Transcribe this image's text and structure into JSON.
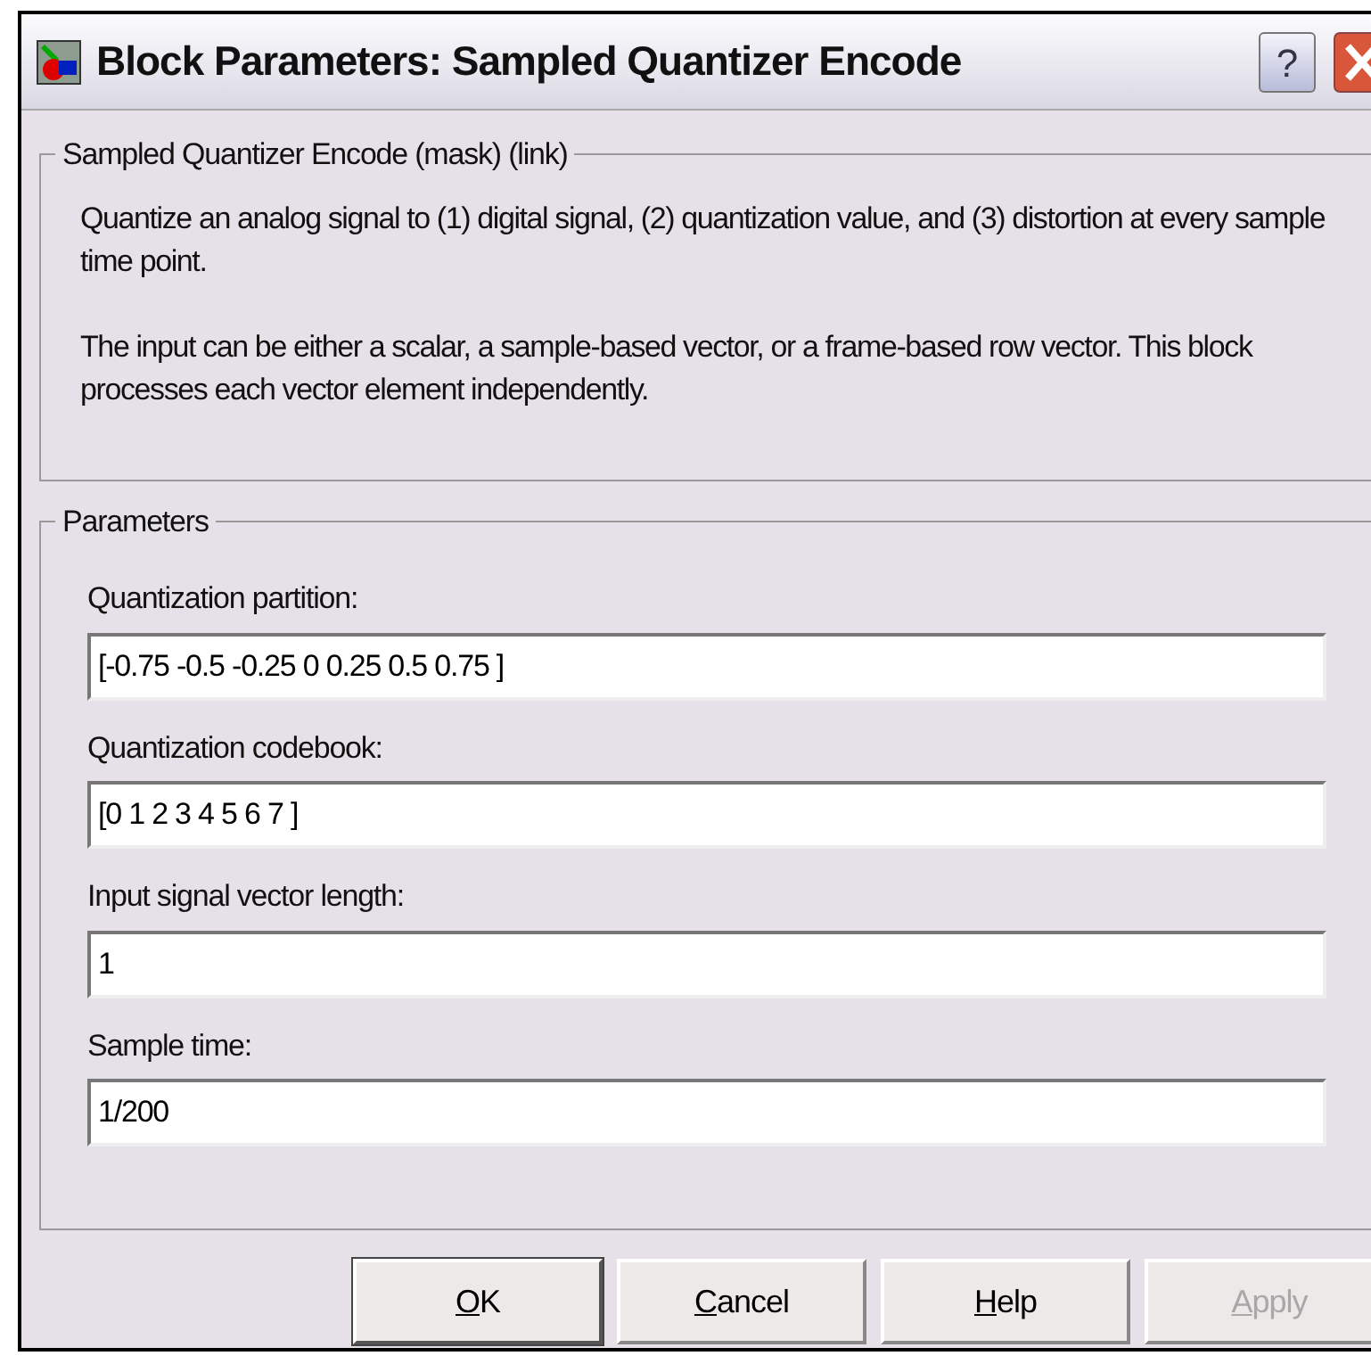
{
  "window": {
    "title": "Block Parameters: Sampled Quantizer Encode",
    "help_glyph": "?"
  },
  "description": {
    "legend": "Sampled Quantizer Encode (mask) (link)",
    "paragraphs": [
      "Quantize an analog signal to (1) digital signal, (2) quantization value, and (3) distortion at every sample time point.",
      "The input can be either a scalar, a sample-based vector, or a frame-based row vector. This block processes each vector element independently."
    ]
  },
  "parameters": {
    "legend": "Parameters",
    "fields": [
      {
        "label": "Quantization partition:",
        "value": "[-0.75 -0.5 -0.25 0 0.25 0.5 0.75 ]"
      },
      {
        "label": "Quantization codebook:",
        "value": "[0 1 2 3 4 5 6 7 ]"
      },
      {
        "label": "Input signal vector length:",
        "value": "1"
      },
      {
        "label": "Sample time:",
        "value": "1/200"
      }
    ]
  },
  "buttons": [
    {
      "key": "O",
      "rest": "K",
      "default": true,
      "disabled": false
    },
    {
      "key": "C",
      "rest": "ancel",
      "default": false,
      "disabled": false
    },
    {
      "key": "H",
      "rest": "elp",
      "default": false,
      "disabled": false
    },
    {
      "key": "A",
      "rest": "pply",
      "default": false,
      "disabled": true
    }
  ]
}
